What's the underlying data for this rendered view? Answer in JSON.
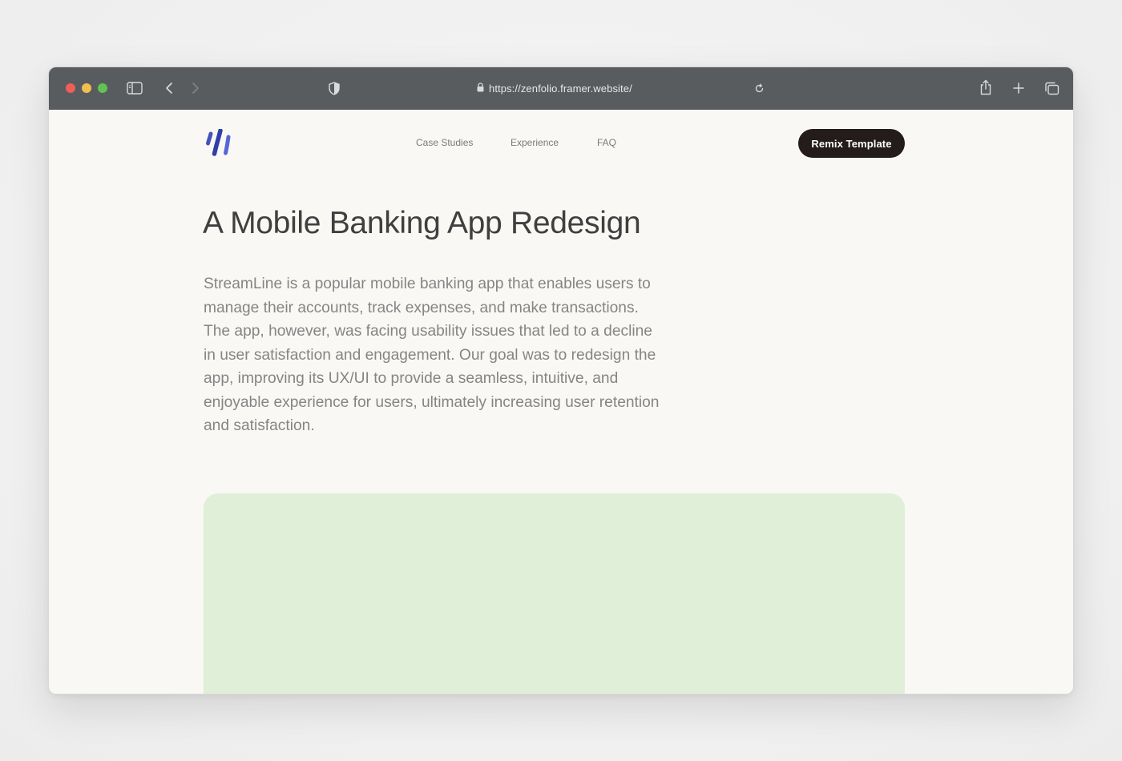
{
  "browser": {
    "url": "https://zenfolio.framer.website/",
    "traffic_lights": {
      "close_color": "#ee5f57",
      "minimize_color": "#f4bd4f",
      "maximize_color": "#5fc453"
    }
  },
  "site": {
    "nav": {
      "links": [
        "Case Studies",
        "Experience",
        "FAQ"
      ],
      "cta_label": "Remix Template"
    },
    "logo_colors": [
      "#2f3fa8",
      "#5566d6"
    ],
    "title": "A Mobile Banking App Redesign",
    "description": "StreamLine is a popular mobile banking app that enables users to manage their accounts, track expenses, and make transactions. The app, however, was facing usability issues that led to a decline in user satisfaction and engagement. Our goal was to redesign the app, improving its UX/UI to provide a seamless, intuitive, and enjoyable experience for users, ultimately increasing user retention and satisfaction.",
    "hero_card_color": "#e0efd7"
  }
}
